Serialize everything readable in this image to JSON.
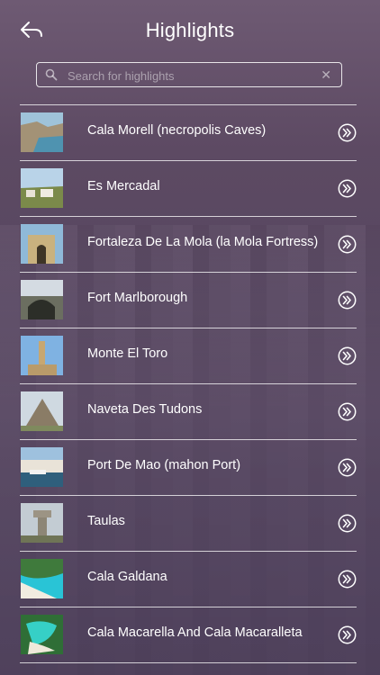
{
  "header": {
    "title": "Highlights"
  },
  "search": {
    "placeholder": "Search for highlights"
  },
  "items": [
    {
      "label": "Cala Morell (necropolis Caves)"
    },
    {
      "label": "Es Mercadal"
    },
    {
      "label": "Fortaleza De La Mola (la Mola Fortress)"
    },
    {
      "label": "Fort Marlborough"
    },
    {
      "label": "Monte El Toro"
    },
    {
      "label": "Naveta Des Tudons"
    },
    {
      "label": "Port De Mao (mahon Port)"
    },
    {
      "label": "Taulas"
    },
    {
      "label": "Cala Galdana"
    },
    {
      "label": "Cala Macarella And Cala Macaralleta"
    }
  ],
  "icons": {
    "back": "back-arrow-icon",
    "search": "search-icon",
    "clear": "clear-icon",
    "chevron": "double-chevron-right-icon"
  }
}
